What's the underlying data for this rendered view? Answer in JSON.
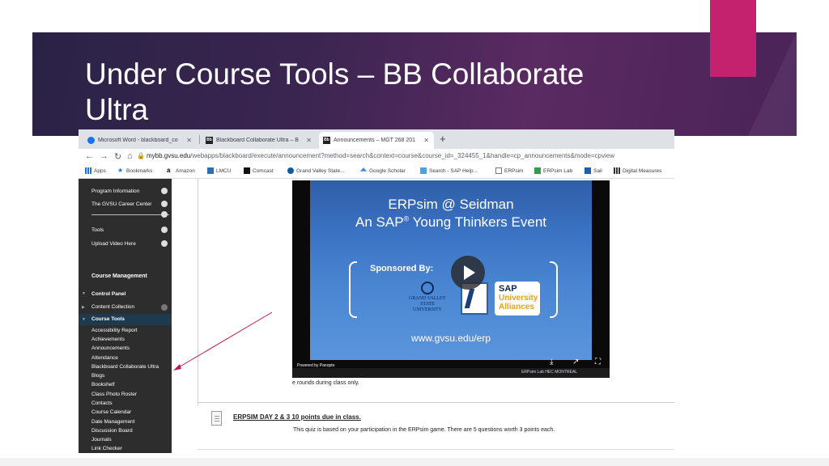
{
  "slide": {
    "title_line1": "Under Course Tools – BB Collaborate",
    "title_line2": "Ultra",
    "accent_color": "#c4216e",
    "band_color": "#3a2550"
  },
  "browser": {
    "tabs": [
      {
        "label": "Microsoft Word - blackboard_co",
        "icon": "word-icon"
      },
      {
        "label": "Blackboard Collaborate Ultra – B",
        "icon": "bb-icon"
      },
      {
        "label": "Announcements – MGT 268 201",
        "icon": "bb-icon",
        "active": true
      }
    ],
    "new_tab": "+",
    "url_host": "mybb.gvsu.edu",
    "url_path": "/webapps/blackboard/execute/announcement?method=search&context=course&course_id=_324455_1&handle=cp_announcements&mode=cpview",
    "bookmarks": [
      {
        "label": "Apps",
        "icon": "apps-icon"
      },
      {
        "label": "Bookmarks",
        "icon": "star-icon"
      },
      {
        "label": "Amazon",
        "icon": "amazon-icon"
      },
      {
        "label": "LMCU",
        "icon": "lmcu-icon"
      },
      {
        "label": "Comcast",
        "icon": "comcast-icon"
      },
      {
        "label": "Grand Valley State...",
        "icon": "gvsu-icon"
      },
      {
        "label": "Google Scholar",
        "icon": "scholar-icon"
      },
      {
        "label": "Search - SAP Help...",
        "icon": "sap-icon"
      },
      {
        "label": "ERPsim",
        "icon": "erpsim-icon"
      },
      {
        "label": "ERPsim Lab",
        "icon": "erpsim-lab-icon"
      },
      {
        "label": "Sail",
        "icon": "sail-icon"
      },
      {
        "label": "Digital Measures",
        "icon": "digital-measures-icon"
      }
    ]
  },
  "sidebar": {
    "top_items": [
      "Program Information",
      "The GVSU Career Center",
      "Tools",
      "Upload Video Here"
    ],
    "course_management": "Course Management",
    "control_panel": "Control Panel",
    "content_collection": "Content Collection",
    "course_tools": "Course Tools",
    "tools_list": [
      "Accessibility Report",
      "Achievements",
      "Announcements",
      "Attendance",
      "Blackboard Collaborate Ultra",
      "Blogs",
      "Bookshelf",
      "Class Photo Roster",
      "Contacts",
      "Course Calendar",
      "Date Management",
      "Discussion Board",
      "Journals",
      "Link Checker"
    ]
  },
  "video": {
    "line1": "ERPsim @ Seidman",
    "line2_pre": "An SAP",
    "line2_sup": "®",
    "line2_post": " Young Thinkers Event",
    "sponsored": "Sponsored By:",
    "gv_line1": "GRAND VALLEY",
    "gv_line2": "STATE UNIVERSITY",
    "sap_1": "SAP",
    "sap_2": "University",
    "sap_3": "Alliances",
    "url": "www.gvsu.edu/erp",
    "powered": "Powered by Panopto",
    "strip_text": "ERPsim Lab   HEC MONTRÉAL"
  },
  "content": {
    "below_video": "e rounds during class only.",
    "quiz_title": "ERPSIM DAY 2 & 3 10 points due in class.",
    "quiz_desc": "This quiz is based on your participation in the ERPsim game. There are 5 questions worth 3 points each."
  }
}
